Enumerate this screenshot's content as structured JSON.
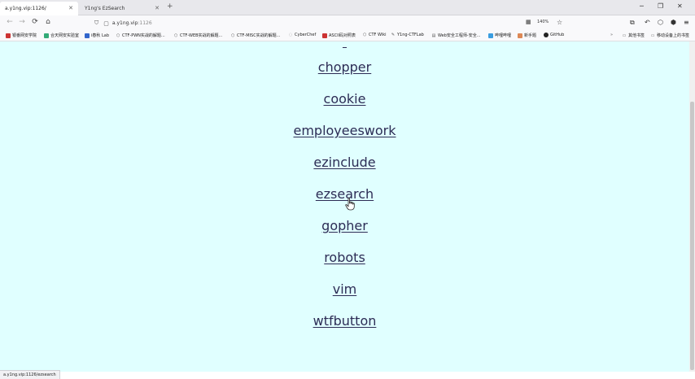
{
  "tabs": [
    {
      "label": "a.y1ng.vip:1126/",
      "active": true
    },
    {
      "label": "Y1ng's EzSearch",
      "active": false
    }
  ],
  "new_tab_label": "+",
  "nav": {
    "back": "←",
    "forward": "→",
    "reload": "⟳",
    "home": "⌂",
    "url_host": "a.y1ng.vip",
    "url_port": ":1126",
    "zoom": "140%"
  },
  "bookmarks": [
    {
      "label": "银番网安学院",
      "icon": "bookmark-icon"
    },
    {
      "label": "合天网安实验室",
      "icon": "bookmark-icon"
    },
    {
      "label": "i春秋 Lab",
      "icon": "bookmark-icon"
    },
    {
      "label": "CTF-PWN实战的解题...",
      "icon": "bookmark-icon"
    },
    {
      "label": "CTF-WEB实战的解题...",
      "icon": "bookmark-icon"
    },
    {
      "label": "CTF-MISC实战的解题...",
      "icon": "bookmark-icon"
    },
    {
      "label": "CyberChef",
      "icon": "bookmark-icon"
    },
    {
      "label": "ASCII码对照表",
      "icon": "bookmark-icon"
    },
    {
      "label": "CTF Wiki",
      "icon": "bookmark-icon"
    },
    {
      "label": "Y1ng-CTFLab",
      "icon": "bookmark-icon"
    },
    {
      "label": "Web安全工程师-安全...",
      "icon": "bookmark-icon"
    },
    {
      "label": "哔哩哔哩",
      "icon": "bookmark-icon"
    },
    {
      "label": "新手题",
      "icon": "bookmark-icon"
    },
    {
      "label": "GitHub",
      "icon": "github-icon"
    }
  ],
  "bookmarks_right": [
    {
      "label": "其他书签"
    },
    {
      "label": "移动设备上的书签"
    }
  ],
  "links": [
    "chopper",
    "cookie",
    "employeeswork",
    "ezinclude",
    "ezsearch",
    "gopher",
    "robots",
    "vim",
    "wtfbutton"
  ],
  "status_url": "a.y1ng.vip:1126/ezsearch",
  "colors": {
    "background": "#e0ffff",
    "link": "#2c2c55"
  }
}
